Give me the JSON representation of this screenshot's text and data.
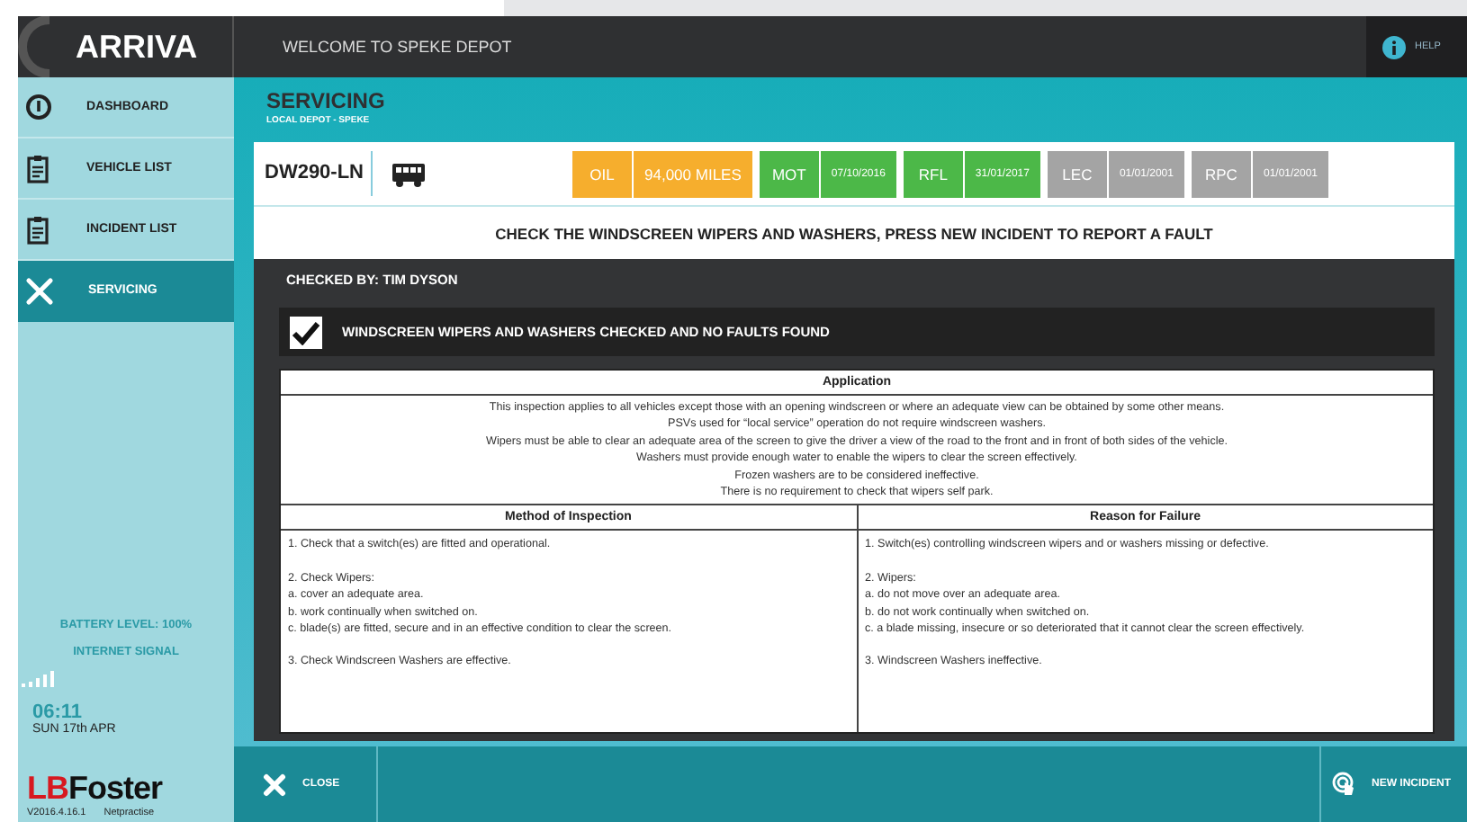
{
  "header": {
    "logo": "ARRIVA",
    "welcome": "WELCOME TO SPEKE DEPOT",
    "help": "HELP"
  },
  "sidebar": {
    "items": [
      {
        "label": "DASHBOARD",
        "kind": "dashboard",
        "selected": false
      },
      {
        "label": "VEHICLE LIST",
        "kind": "list",
        "selected": false
      },
      {
        "label": "INCIDENT LIST",
        "kind": "list",
        "selected": false
      },
      {
        "label": "SERVICING",
        "kind": "servicing",
        "selected": true
      }
    ],
    "battery": "BATTERY LEVEL: 100%",
    "signal": "INTERNET SIGNAL",
    "time": "06:11",
    "date": "SUN 17th APR",
    "brand_red": "LB",
    "brand_black": "Foster",
    "version": "V2016.4.16.1",
    "company": "Netpractise"
  },
  "page": {
    "title": "SERVICING",
    "subtitle": "LOCAL DEPOT - SPEKE"
  },
  "vehicle": {
    "registration": "DW290-LN",
    "badges": [
      {
        "label": "OIL",
        "value": "94,000 MILES",
        "kind": "warning"
      },
      {
        "label": "MOT",
        "value": "07/10/2016",
        "kind": "ok"
      },
      {
        "label": "RFL",
        "value": "31/01/2017",
        "kind": "ok"
      },
      {
        "label": "LEC",
        "value": "01/01/2001",
        "kind": "inactive"
      },
      {
        "label": "RPC",
        "value": "01/01/2001",
        "kind": "inactive"
      }
    ]
  },
  "instruction": "CHECK THE WINDSCREEN WIPERS AND WASHERS, PRESS NEW INCIDENT TO REPORT A FAULT",
  "checked_by": "CHECKED BY: TIM DYSON",
  "check": {
    "label": "WINDSCREEN WIPERS AND WASHERS CHECKED AND NO FAULTS FOUND",
    "checked": true
  },
  "table": {
    "application_heading": "Application",
    "application": [
      "This inspection applies to all vehicles except those with an opening windscreen or where an adequate view can be obtained by some other means.",
      "PSVs used for “local service” operation do not require windscreen washers.",
      "Wipers must be able to clear an adequate area of the screen to give the driver a view of the road to the front and in front of both sides of the vehicle.",
      "Washers must provide enough water to enable the wipers to clear the screen effectively.",
      "Frozen washers are to be considered ineffective.",
      "There is no requirement to check that wipers self park."
    ],
    "columns": [
      {
        "heading": "Method of Inspection",
        "paragraphs": [
          [
            "1. Check that a switch(es) are fitted and operational."
          ],
          [
            "2. Check Wipers:",
            "a. cover an adequate area.",
            "b. work continually when switched on.",
            "c. blade(s) are fitted, secure and in an effective condition to clear the screen."
          ],
          [
            "3. Check Windscreen Washers are effective."
          ]
        ]
      },
      {
        "heading": "Reason for Failure",
        "paragraphs": [
          [
            "1. Switch(es) controlling windscreen wipers and or washers missing or defective."
          ],
          [
            "2. Wipers:",
            "a. do not move over an adequate area.",
            "b. do not work continually when switched on.",
            "c. a blade missing, insecure or so deteriorated that it cannot clear the screen effectively."
          ],
          [
            "3. Windscreen Washers ineffective."
          ]
        ]
      }
    ]
  },
  "footer": {
    "close": "CLOSE",
    "new_incident": "NEW INCIDENT"
  }
}
